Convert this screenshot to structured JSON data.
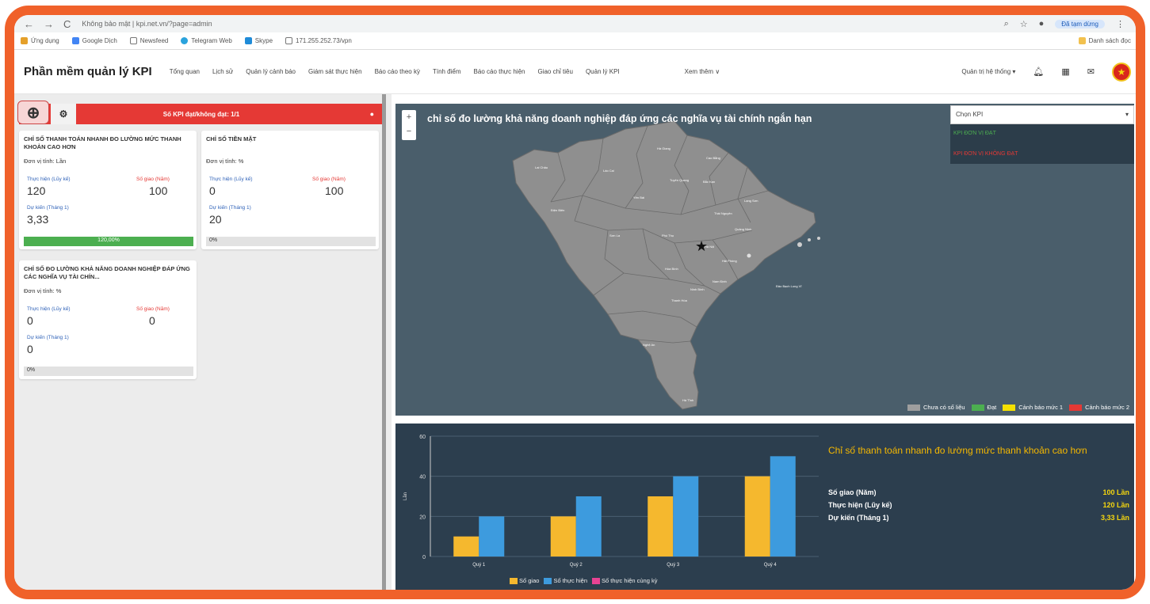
{
  "browser": {
    "nav": [
      "←",
      "→",
      "C"
    ],
    "url": "Không bảo mật | kpi.net.vn/?page=admin",
    "profile": "Đã tạm dừng",
    "bookmarks": [
      "Ứng dụng",
      "Google Dịch",
      "Newsfeed",
      "Telegram Web",
      "Skype",
      "171.255.252.73/vpn"
    ],
    "bookmarks_right": "Danh sách đọc",
    "icons": [
      "search-icon",
      "star-icon",
      "extension-icon",
      "menu-icon"
    ]
  },
  "app": {
    "title": "Phần mềm quản lý KPI",
    "menu": [
      "Tổng quan",
      "Lịch sử",
      "Quản lý cảnh báo",
      "Giám sát thực hiện",
      "Báo cáo theo kỳ",
      "Tính điểm",
      "Báo cáo thực hiện",
      "Giao chỉ tiêu",
      "Quản lý KPI"
    ],
    "more": "Xem thêm ∨",
    "system": "Quản trị hệ thống ▾",
    "header_icons": [
      "bell-icon",
      "grid-icon",
      "chat-icon",
      "emblem-icon"
    ]
  },
  "left": {
    "red_banner": "Số KPI đạt/không đạt: 1/1",
    "cards": [
      {
        "title": "CHỈ SỐ THANH TOÁN NHANH ĐO LƯỜNG MỨC THANH KHOẢN CAO HƠN",
        "unit": "Đơn vị tính: Lần",
        "actual_label": "Thực hiện (Lũy kế)",
        "actual": "120",
        "target_label": "Số giao (Năm)",
        "target": "100",
        "forecast_label": "Dự kiến (Tháng 1)",
        "forecast": "3,33",
        "progress": 1.2,
        "progress_text": "120,00%"
      },
      {
        "title": "CHỈ SỐ TIỀN MẶT",
        "unit": "Đơn vị tính: %",
        "actual_label": "Thực hiện (Lũy kế)",
        "actual": "0",
        "target_label": "Số giao (Năm)",
        "target": "100",
        "forecast_label": "Dự kiến (Tháng 1)",
        "forecast": "20",
        "progress": 0,
        "progress_text": "0%"
      },
      {
        "title": "CHỈ SỐ ĐO LƯỜNG KHẢ NĂNG DOANH NGHIỆP ĐÁP ỨNG CÁC NGHĨA VỤ TÀI CHÍN...",
        "unit": "Đơn vị tính: %",
        "actual_label": "Thực hiện (Lũy kế)",
        "actual": "0",
        "target_label": "Số giao (Năm)",
        "target": "0",
        "forecast_label": "Dự kiến (Tháng 1)",
        "forecast": "0",
        "progress": 0,
        "progress_text": "0%"
      }
    ]
  },
  "map": {
    "title": "chỉ số đo lường khả năng doanh nghiệp đáp ứng các nghĩa vụ tài chính ngắn hạn",
    "zoom_in": "+",
    "zoom_out": "−",
    "select_placeholder": "Chọn KPI",
    "select_options": [
      "KPI ĐƠN VỊ ĐẠT",
      "KPI ĐƠN VỊ KHÔNG ĐẠT"
    ],
    "select_option_colors": [
      "#4caf50",
      "#e53935"
    ],
    "region_fill": "#8f8f8f",
    "legend": [
      {
        "label": "Chưa có số liệu",
        "color": "#9e9e9e"
      },
      {
        "label": "Đạt",
        "color": "#4caf50"
      },
      {
        "label": "Cảnh báo mức 1",
        "color": "#f5e000"
      },
      {
        "label": "Cảnh báo mức 2",
        "color": "#e53935"
      }
    ],
    "province_labels": [
      "Lai Châu",
      "Lào Cai",
      "Hà Giang",
      "Cao Bằng",
      "Lạng Sơn",
      "Điện Biên",
      "Sơn La",
      "Yên Bái",
      "Tuyên Quang",
      "Bắc Kạn",
      "Thái Nguyên",
      "Phú Thọ",
      "Hòa Bình",
      "Quảng Ninh",
      "Hà Nội",
      "Hải Phòng",
      "Nam Định",
      "Ninh Bình",
      "Thanh Hóa",
      "Nghệ An",
      "Hà Tĩnh",
      "Đảo Bạch Long Vĩ"
    ]
  },
  "bar": {
    "side_title": "Chỉ số thanh toán nhanh đo lường mức thanh khoản cao hơn",
    "stats": [
      {
        "label": "Số giao (Năm)",
        "value": "100 Lần"
      },
      {
        "label": "Thực hiện (Lũy kế)",
        "value": "120 Lần"
      },
      {
        "label": "Dự kiến (Tháng 1)",
        "value": "3,33 Lần"
      }
    ]
  },
  "chart_data": {
    "type": "bar",
    "categories": [
      "Quý 1",
      "Quý 2",
      "Quý 3",
      "Quý 4"
    ],
    "series": [
      {
        "name": "Số giao",
        "values": [
          10,
          20,
          30,
          40
        ],
        "color": "#f5b82e"
      },
      {
        "name": "Số thực hiện",
        "values": [
          20,
          30,
          40,
          50
        ],
        "color": "#3d9bde"
      },
      {
        "name": "Số thực hiện cùng kỳ",
        "values": [
          0,
          0,
          0,
          0
        ],
        "color": "#e84393"
      }
    ],
    "ylim": [
      0,
      60
    ],
    "yticks": [
      0,
      20,
      40,
      60
    ],
    "ylabel": "Lần",
    "grid": true,
    "legend": "bottom"
  }
}
